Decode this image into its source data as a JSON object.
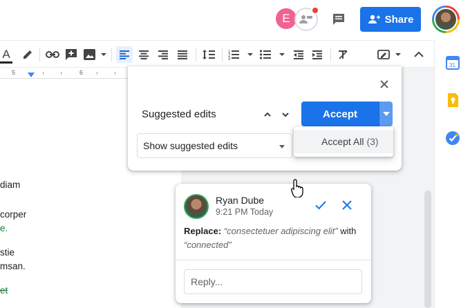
{
  "header": {
    "collaborator_initial": "E",
    "share_label": "Share"
  },
  "ruler": {
    "marks": [
      "5",
      "6"
    ]
  },
  "document": {
    "lines": [
      {
        "text": "diam",
        "style": "normal"
      },
      {
        "text": "corper",
        "style": "normal"
      },
      {
        "text": "e.",
        "style": "green"
      },
      {
        "text": "stie",
        "style": "normal"
      },
      {
        "text": "msan.",
        "style": "normal"
      },
      {
        "text": "et",
        "style": "strike"
      }
    ]
  },
  "suggested_edits": {
    "title": "Suggested edits",
    "accept_label": "Accept",
    "view_mode": "Show suggested edits",
    "menu": {
      "accept_all_label": "Accept All",
      "accept_all_count": "(3)"
    }
  },
  "comment": {
    "author": "Ryan Dube",
    "time": "9:21 PM Today",
    "action_label": "Replace:",
    "original_text": "“consectetuer adipiscing elit”",
    "connector": "with",
    "replacement_text": "“connected”",
    "reply_placeholder": "Reply..."
  },
  "side_panel": {
    "icons": [
      "calendar-icon",
      "keep-icon",
      "tasks-icon"
    ]
  },
  "colors": {
    "primary": "#1a73e8",
    "suggestion_green": "#188038",
    "background": "#f1f3f4"
  }
}
